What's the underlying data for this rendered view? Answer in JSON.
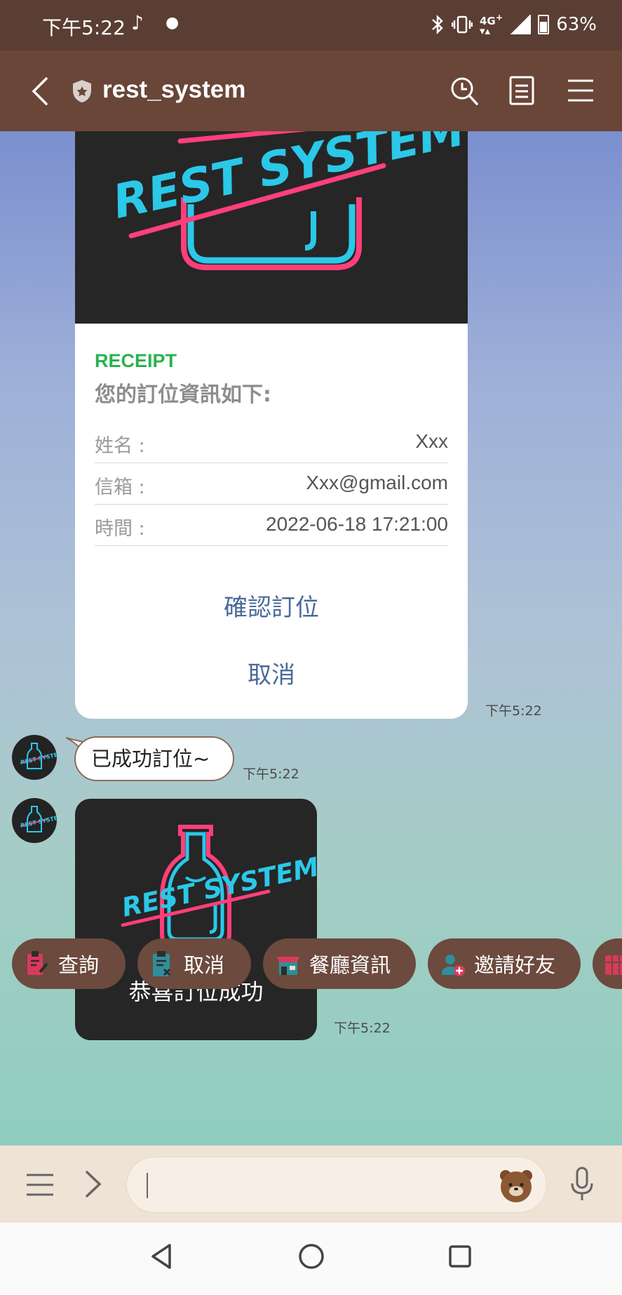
{
  "status_bar": {
    "time": "下午5:22",
    "network": "4G",
    "network_plus": "+",
    "battery": "63%",
    "icons": [
      "music-note-icon",
      "bluetooth-icon",
      "vibrate-icon",
      "signal-icon",
      "battery-icon"
    ]
  },
  "header": {
    "title": "rest_system",
    "icons": [
      "back-icon",
      "shield-icon",
      "search-icon",
      "notes-icon",
      "menu-icon"
    ]
  },
  "receipt": {
    "hero_logo_text": "REST SYSTEM",
    "label": "RECEIPT",
    "title": "您的訂位資訊如下:",
    "rows": [
      {
        "key": "姓名 :",
        "value": "Xxx"
      },
      {
        "key": "信箱 :",
        "value": "Xxx@gmail.com"
      },
      {
        "key": "時間 :",
        "value": "2022-06-18 17:21:00"
      }
    ],
    "confirm_label": "確認訂位",
    "cancel_label": "取消",
    "timestamp": "下午5:22"
  },
  "messages": [
    {
      "text": "已成功訂位~",
      "timestamp": "下午5:22"
    },
    {
      "logo_text": "REST SYSTEM",
      "caption": "恭喜訂位成功",
      "timestamp": "下午5:22"
    }
  ],
  "quick_replies": [
    {
      "label": "查詢",
      "icon": "search-clipboard-icon"
    },
    {
      "label": "取消",
      "icon": "cancel-clipboard-icon"
    },
    {
      "label": "餐廳資訊",
      "icon": "store-icon"
    },
    {
      "label": "邀請好友",
      "icon": "add-friend-icon"
    }
  ],
  "composer": {
    "icons": [
      "menu-icon",
      "chevron-right-icon",
      "bear-sticker-icon",
      "microphone-icon"
    ]
  },
  "colors": {
    "header_bg": "#6a4638",
    "status_bg": "#5a3e33",
    "receipt_label": "#2ab24f",
    "action_text": "#4a6a9a",
    "quick_reply_bg": "#6c4a3d",
    "neon_pink": "#ff3f7a",
    "neon_cyan": "#2bc8e8"
  }
}
